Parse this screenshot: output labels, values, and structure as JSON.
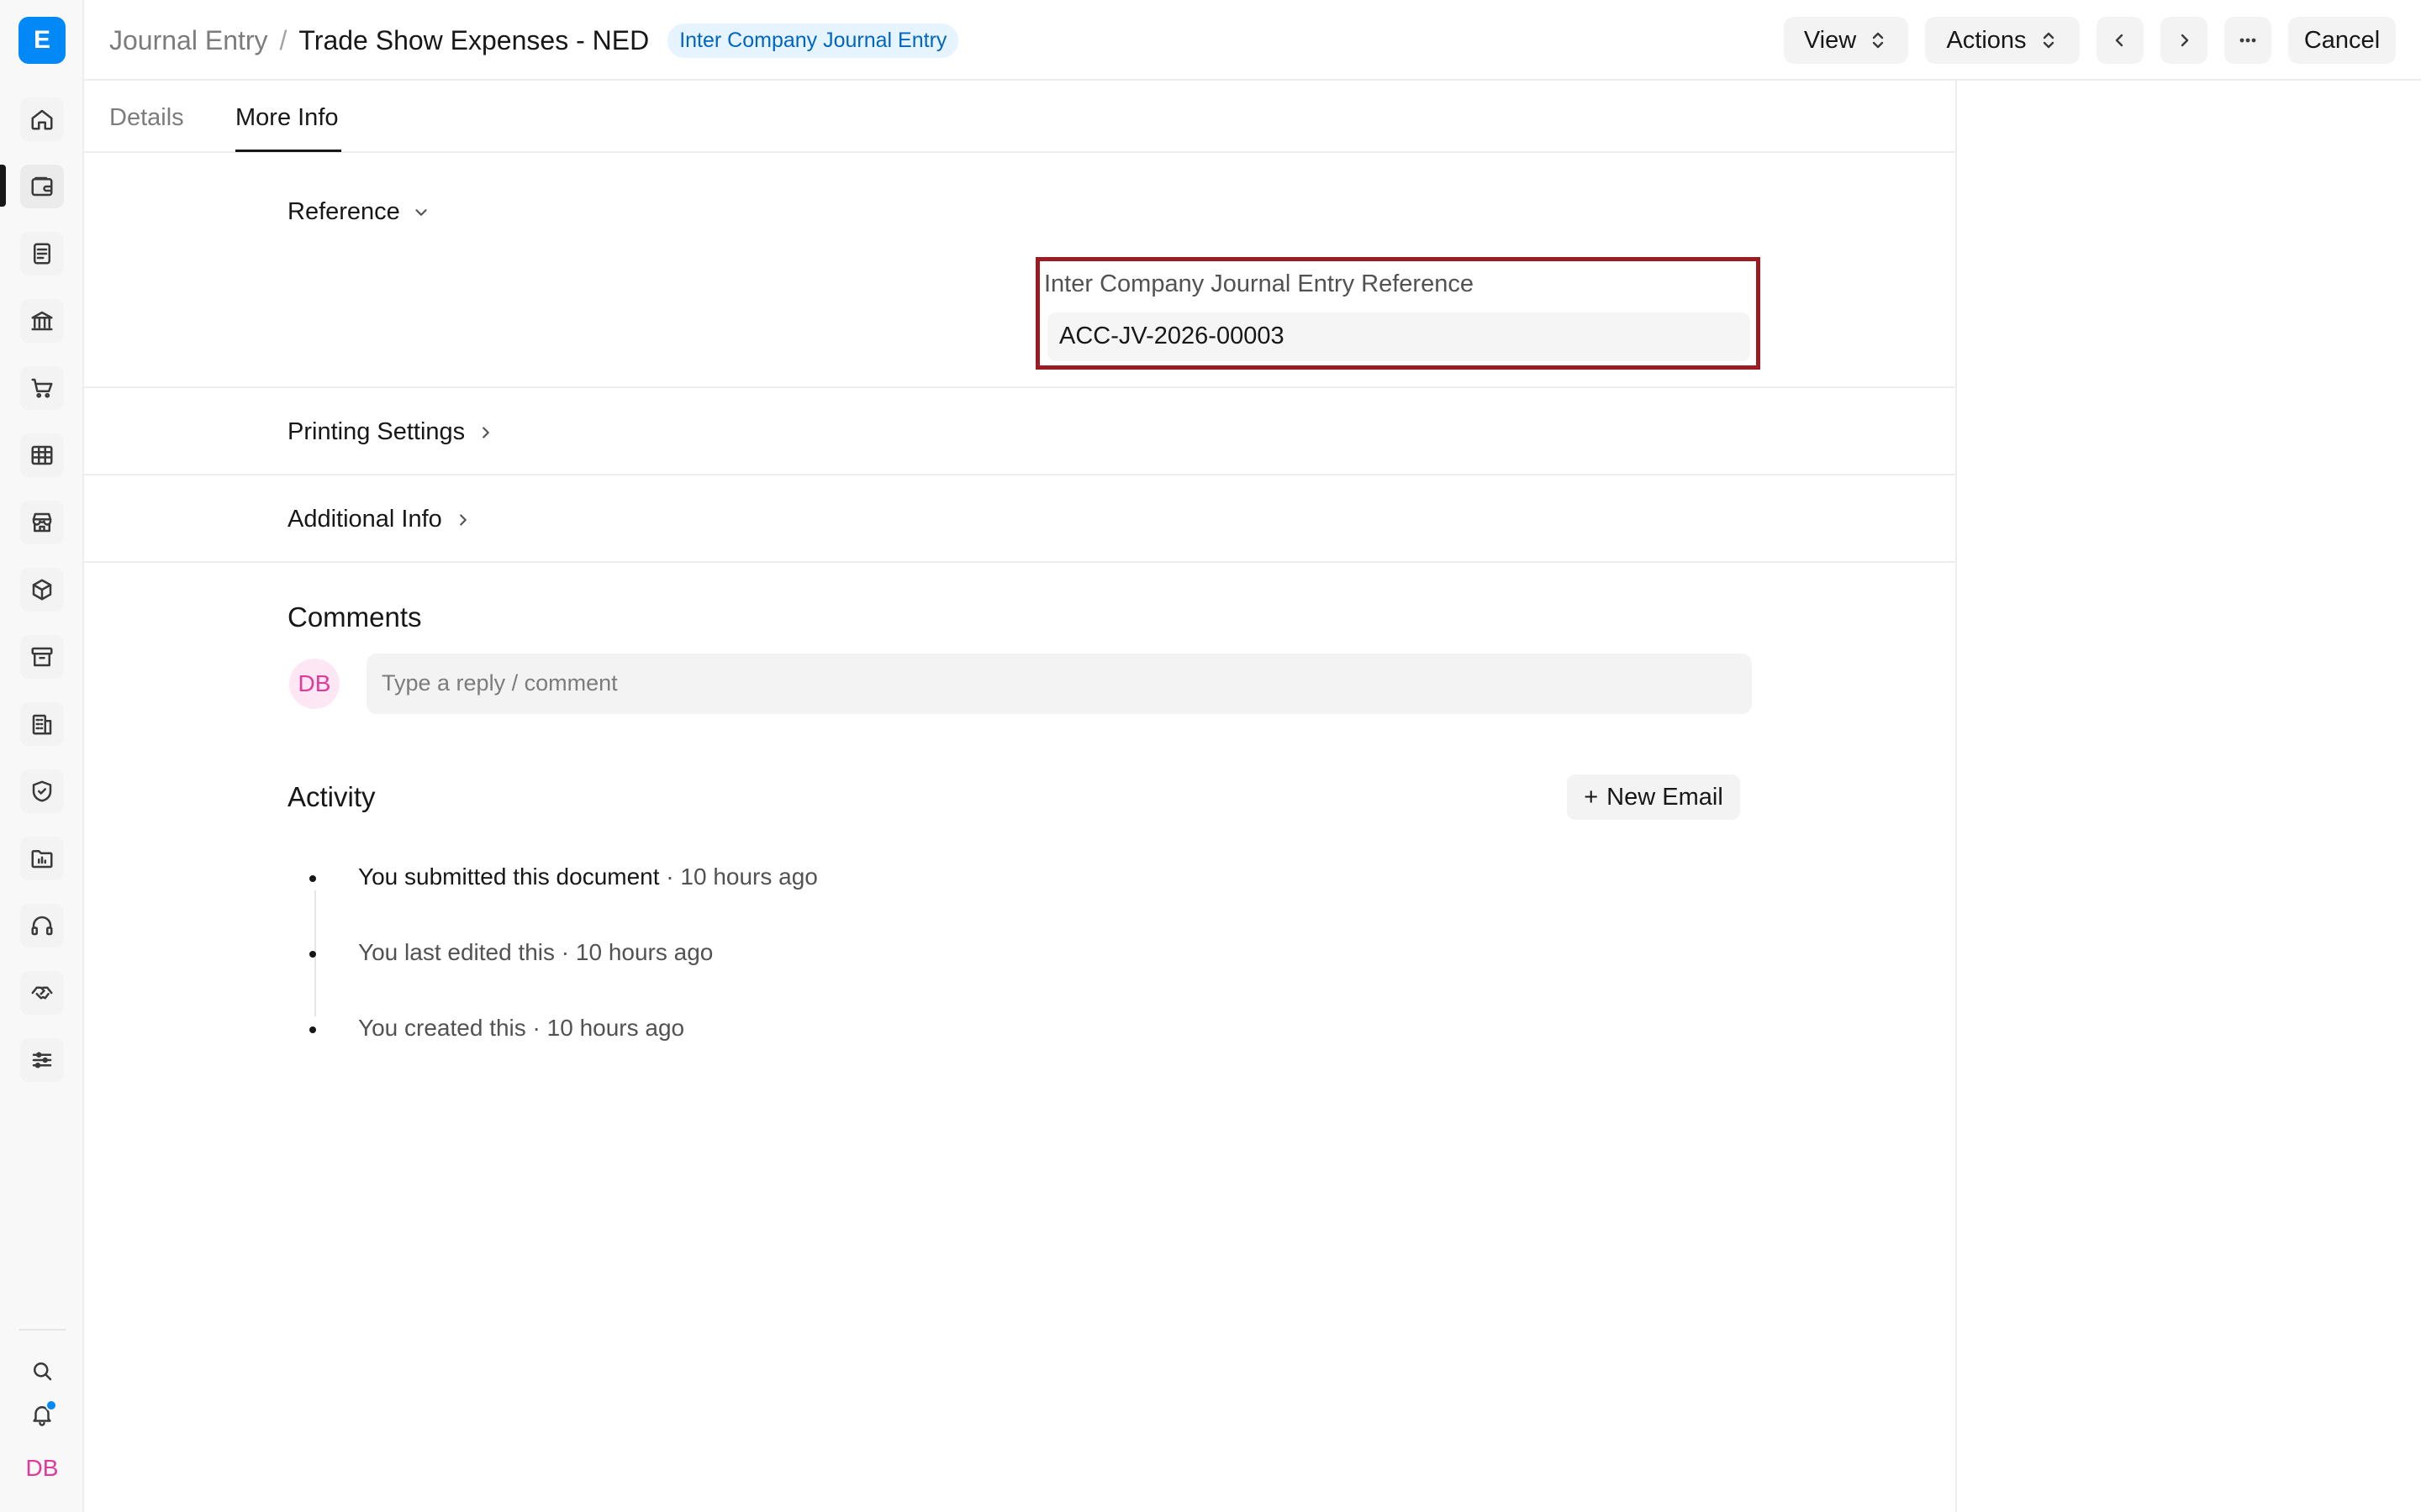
{
  "sidebar": {
    "logo_letter": "E",
    "icons": [
      "home-icon",
      "wallet-icon",
      "document-icon",
      "bank-icon",
      "cart-icon",
      "table-icon",
      "store-icon",
      "package-icon",
      "archive-icon",
      "building-icon",
      "shield-icon",
      "folder-chart-icon",
      "headset-icon",
      "handshake-icon",
      "sliders-icon"
    ],
    "bottom": {
      "search": "search-icon",
      "notifications": "bell-icon",
      "user_initials": "DB"
    }
  },
  "header": {
    "breadcrumb_parent": "Journal Entry",
    "breadcrumb_separator": "/",
    "title": "Trade Show Expenses - NED",
    "status_badge": "Inter Company Journal Entry",
    "view_label": "View",
    "actions_label": "Actions",
    "cancel_label": "Cancel"
  },
  "tabs": [
    {
      "label": "Details",
      "active": false
    },
    {
      "label": "More Info",
      "active": true
    }
  ],
  "reference_section": {
    "title": "Reference",
    "field_label": "Inter Company Journal Entry Reference",
    "field_value": "ACC-JV-2026-00003"
  },
  "collapsed_sections": [
    {
      "title": "Printing Settings"
    },
    {
      "title": "Additional Info"
    }
  ],
  "comments": {
    "title": "Comments",
    "avatar_initials": "DB",
    "placeholder": "Type a reply / comment"
  },
  "activity": {
    "title": "Activity",
    "new_email_label": "New Email",
    "items": [
      {
        "text": "You submitted this document",
        "time": " · 10 hours ago"
      },
      {
        "text": "You last edited this",
        "time": " · 10 hours ago"
      },
      {
        "text": "You created this",
        "time": " · 10 hours ago"
      }
    ]
  },
  "colors": {
    "brand": "#0289f7",
    "badge_bg": "#e6f4ff",
    "badge_text": "#0066c2",
    "highlight_border": "#9b1b22",
    "avatar": "#e03a9c"
  }
}
